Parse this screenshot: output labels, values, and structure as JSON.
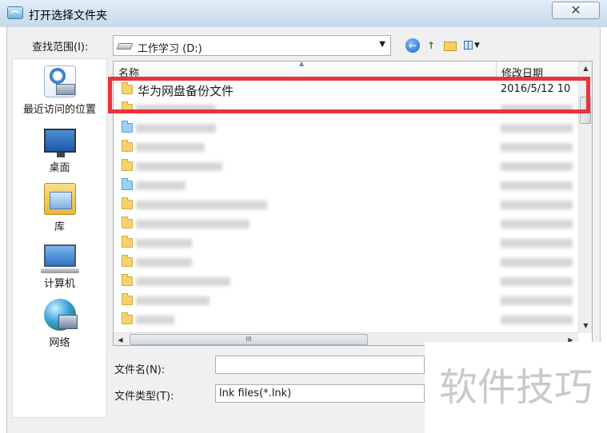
{
  "window": {
    "title": "打开选择文件夹",
    "close_label": "✕"
  },
  "toolbar": {
    "lookin_label": "查找范围(I):",
    "lookin_value": "工作学习 (D:)",
    "back_icon": "back-arrow-icon",
    "up_icon": "up-folder-icon",
    "new_folder_icon": "new-folder-icon",
    "view_icon": "view-menu-icon"
  },
  "places": [
    {
      "label": "最近访问的位置",
      "icon": "recent-places-icon"
    },
    {
      "label": "桌面",
      "icon": "desktop-icon"
    },
    {
      "label": "库",
      "icon": "libraries-icon"
    },
    {
      "label": "计算机",
      "icon": "computer-icon"
    },
    {
      "label": "网络",
      "icon": "network-icon"
    }
  ],
  "filelist": {
    "columns": {
      "name": "名称",
      "date": "修改日期"
    },
    "highlighted_row": {
      "name": "华为网盘备份文件",
      "date": "2016/5/12 10"
    }
  },
  "bottom": {
    "filename_label": "文件名(N):",
    "filename_value": "",
    "filetype_label": "文件类型(T):",
    "filetype_value": "lnk files(*.lnk)"
  },
  "watermark": {
    "text": "软件技巧"
  },
  "colors": {
    "highlight_border": "#e8343a",
    "titlebar": "#d3e2f1"
  }
}
